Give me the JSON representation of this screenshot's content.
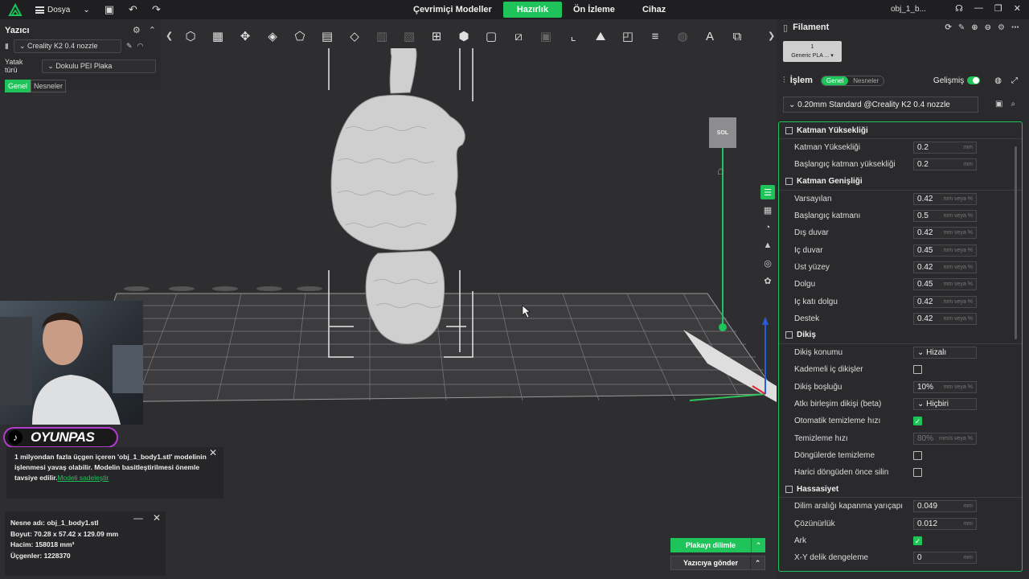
{
  "topbar": {
    "menu_label": "Dosya",
    "tabs": [
      "Çevrimiçi Modeller",
      "Hazırlık",
      "Ön İzleme",
      "Cihaz"
    ],
    "file_name": "obj_1_b..."
  },
  "printer_panel": {
    "title": "Yazıcı",
    "nozzle": "Creality K2 0.4 nozzle",
    "bed_label": "Yatak türü",
    "bed_value": "Dokulu PEI Plaka",
    "seg_general": "Genel",
    "seg_objects": "Nesneler"
  },
  "viewport": {
    "nav_cube_label": "SOL"
  },
  "overlay": {
    "tiktok_name": "OYUNPAS"
  },
  "notice": {
    "text": "1 milyondan fazla üçgen içeren 'obj_1_body1.stl' modelinin işlenmesi yavaş olabilir. Modelin basitleştirilmesi önemle tavsiye edilir.",
    "link": "Modeli sadeleştir"
  },
  "object_info": {
    "name": "Nesne adı: obj_1_body1.stl",
    "size": "Boyut: 70.28 x 57.42 x 129.09 mm",
    "volume": "Hacim: 158018 mm³",
    "triangles": "Üçgenler: 1228370"
  },
  "actions": {
    "slice": "Plakayı dilimle",
    "send": "Yazıcıya gönder"
  },
  "right_panel": {
    "filament_title": "Filament",
    "filament_slot_num": "1",
    "filament_slot_name": "Generic PLA ...",
    "process_title": "İşlem",
    "pill_general": "Genel",
    "pill_objects": "Nesneler",
    "advanced_label": "Gelişmiş",
    "preset": "0.20mm Standard @Creality K2 0.4 nozzle",
    "sections": {
      "layer_height": "Katman Yüksekliği",
      "line_width": "Katman Genişliği",
      "seam": "Dikiş",
      "precision": "Hassasiyet"
    },
    "rows": {
      "layer_height": {
        "label": "Katman Yüksekliği",
        "value": "0.2",
        "unit": "mm"
      },
      "initial_layer_height": {
        "label": "Başlangıç katman yüksekliği",
        "value": "0.2",
        "unit": "mm"
      },
      "default_width": {
        "label": "Varsayılan",
        "value": "0.42",
        "unit": "mm veya %"
      },
      "initial_layer_width": {
        "label": "Başlangıç katmanı",
        "value": "0.5",
        "unit": "mm veya %"
      },
      "outer_wall": {
        "label": "Dış duvar",
        "value": "0.42",
        "unit": "mm veya %"
      },
      "inner_wall": {
        "label": "İç duvar",
        "value": "0.45",
        "unit": "mm veya %"
      },
      "top_surface": {
        "label": "Üst yüzey",
        "value": "0.42",
        "unit": "mm veya %"
      },
      "infill": {
        "label": "Dolgu",
        "value": "0.45",
        "unit": "mm veya %"
      },
      "internal_solid": {
        "label": "İç katı dolgu",
        "value": "0.42",
        "unit": "mm veya %"
      },
      "support": {
        "label": "Destek",
        "value": "0.42",
        "unit": "mm veya %"
      },
      "seam_position": {
        "label": "Dikiş konumu",
        "value": "Hizalı"
      },
      "staggered_seams": {
        "label": "Kademeli iç dikişler"
      },
      "seam_gap": {
        "label": "Dikiş boşluğu",
        "value": "10%",
        "unit": "mm veya %"
      },
      "scarf_seam": {
        "label": "Atkı birleşim dikişi (beta)",
        "value": "Hiçbiri"
      },
      "auto_wipe_speed": {
        "label": "Otomatik temizleme hızı"
      },
      "wipe_speed": {
        "label": "Temizleme hızı",
        "value": "80%",
        "unit": "mm/s veya %"
      },
      "wipe_loops": {
        "label": "Döngülerde temizleme"
      },
      "wipe_before_external": {
        "label": "Harici döngüden önce silin"
      },
      "slice_closing_radius": {
        "label": "Dilim aralığı kapanma yarıçapı",
        "value": "0.049",
        "unit": "mm"
      },
      "resolution": {
        "label": "Çözünürlük",
        "value": "0.012",
        "unit": "mm"
      },
      "arc": {
        "label": "Ark"
      },
      "xy_hole_comp": {
        "label": "X-Y delik dengeleme",
        "value": "0",
        "unit": "mm"
      }
    }
  },
  "colors": {
    "accent": "#1ec45a",
    "background": "#2e2e30",
    "panel": "#2a2a2c"
  }
}
